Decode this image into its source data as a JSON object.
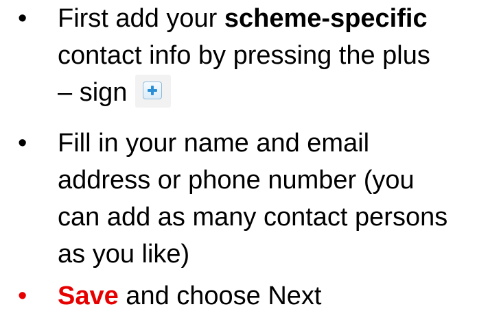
{
  "bullets": [
    {
      "lines": [
        [
          "First add your ",
          "scheme-specific"
        ],
        [
          "contact info by pressing the plus"
        ],
        [
          "– sign"
        ]
      ]
    },
    {
      "lines": [
        [
          "Fill in your name and email"
        ],
        [
          "address or phone number (you"
        ],
        [
          "can add as many contact persons"
        ],
        [
          "as you like)"
        ]
      ]
    },
    {
      "lines": [
        [
          "Save",
          " and choose Next"
        ]
      ]
    }
  ],
  "bullet_symbol": "•",
  "icons": {
    "plus": "plus-icon"
  },
  "colors": {
    "text": "#000000",
    "highlight": "#e60000",
    "plus_icon": "#2a8fd6"
  }
}
